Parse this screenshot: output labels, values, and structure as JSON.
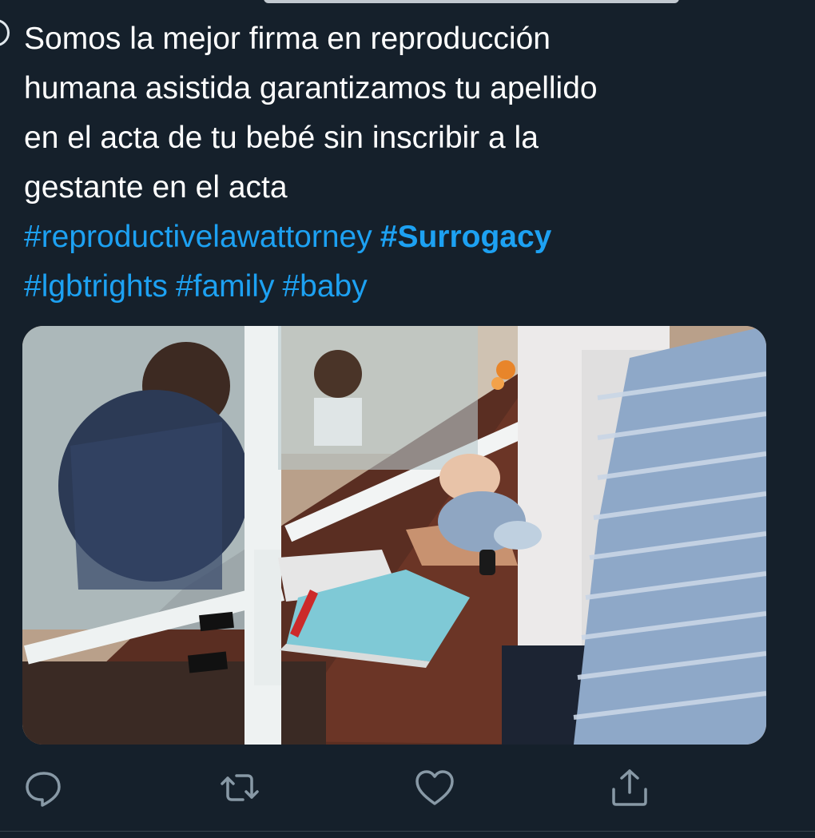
{
  "tweet": {
    "text": "Somos la mejor firma en reproducción\nhumana asistida garantizamos tu apellido\nen el acta de tu bebé sin inscribir a la\ngestante en el acta",
    "hashtags": [
      {
        "text": "#reproductivelawattorney",
        "bold": false
      },
      {
        "text": "#Surrogacy",
        "bold": true
      },
      {
        "text": "#lgbtrights",
        "bold": false
      },
      {
        "text": "#family",
        "bold": false
      },
      {
        "text": "#baby",
        "bold": false
      }
    ]
  },
  "media": {
    "icon": "photo"
  },
  "actions": [
    {
      "name": "reply",
      "icon": "speech-bubble-icon"
    },
    {
      "name": "retweet",
      "icon": "retweet-icon"
    },
    {
      "name": "like",
      "icon": "heart-icon"
    },
    {
      "name": "share",
      "icon": "share-icon"
    }
  ],
  "colors": {
    "background": "#15202b",
    "text": "#ffffff",
    "link": "#1da1f2",
    "icon": "#8899a6"
  }
}
